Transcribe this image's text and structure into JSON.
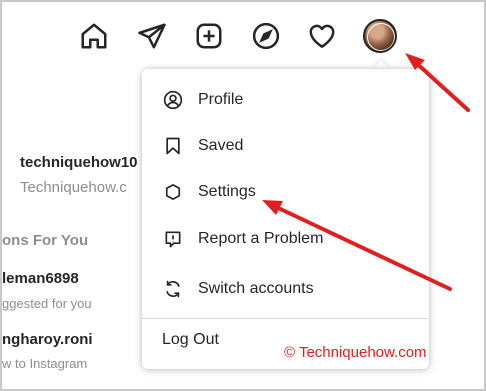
{
  "nav": {
    "icons": [
      "home-icon",
      "direct-message-icon",
      "new-post-icon",
      "explore-icon",
      "activity-heart-icon",
      "profile-avatar"
    ]
  },
  "background": {
    "user_name": "techniquehow10",
    "user_display": "Techniquehow.c",
    "suggestions_title": "ons For You",
    "suggestions": [
      {
        "name": "leman6898",
        "sub": "ggested for you"
      },
      {
        "name": "ngharoy.roni",
        "sub": "w to Instagram"
      }
    ]
  },
  "menu": {
    "items": [
      {
        "label": "Profile",
        "icon": "profile-icon"
      },
      {
        "label": "Saved",
        "icon": "bookmark-icon"
      },
      {
        "label": "Settings",
        "icon": "settings-gear-icon"
      },
      {
        "label": "Report a Problem",
        "icon": "report-problem-icon"
      },
      {
        "label": "Switch accounts",
        "icon": "switch-accounts-icon"
      }
    ],
    "logout_label": "Log Out"
  },
  "watermark": "© Techniquehow.com",
  "colors": {
    "annotation_arrow": "#e02020",
    "text": "#262626",
    "muted": "#8e8e8e"
  }
}
